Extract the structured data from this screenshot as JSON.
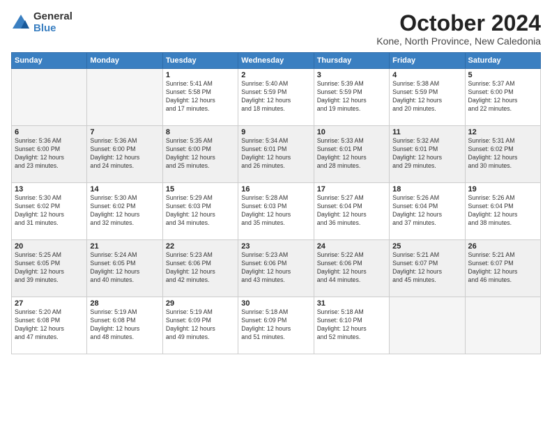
{
  "logo": {
    "general": "General",
    "blue": "Blue"
  },
  "title": "October 2024",
  "location": "Kone, North Province, New Caledonia",
  "days_of_week": [
    "Sunday",
    "Monday",
    "Tuesday",
    "Wednesday",
    "Thursday",
    "Friday",
    "Saturday"
  ],
  "weeks": [
    [
      {
        "num": "",
        "info": ""
      },
      {
        "num": "",
        "info": ""
      },
      {
        "num": "1",
        "info": "Sunrise: 5:41 AM\nSunset: 5:58 PM\nDaylight: 12 hours\nand 17 minutes."
      },
      {
        "num": "2",
        "info": "Sunrise: 5:40 AM\nSunset: 5:59 PM\nDaylight: 12 hours\nand 18 minutes."
      },
      {
        "num": "3",
        "info": "Sunrise: 5:39 AM\nSunset: 5:59 PM\nDaylight: 12 hours\nand 19 minutes."
      },
      {
        "num": "4",
        "info": "Sunrise: 5:38 AM\nSunset: 5:59 PM\nDaylight: 12 hours\nand 20 minutes."
      },
      {
        "num": "5",
        "info": "Sunrise: 5:37 AM\nSunset: 6:00 PM\nDaylight: 12 hours\nand 22 minutes."
      }
    ],
    [
      {
        "num": "6",
        "info": "Sunrise: 5:36 AM\nSunset: 6:00 PM\nDaylight: 12 hours\nand 23 minutes."
      },
      {
        "num": "7",
        "info": "Sunrise: 5:36 AM\nSunset: 6:00 PM\nDaylight: 12 hours\nand 24 minutes."
      },
      {
        "num": "8",
        "info": "Sunrise: 5:35 AM\nSunset: 6:00 PM\nDaylight: 12 hours\nand 25 minutes."
      },
      {
        "num": "9",
        "info": "Sunrise: 5:34 AM\nSunset: 6:01 PM\nDaylight: 12 hours\nand 26 minutes."
      },
      {
        "num": "10",
        "info": "Sunrise: 5:33 AM\nSunset: 6:01 PM\nDaylight: 12 hours\nand 28 minutes."
      },
      {
        "num": "11",
        "info": "Sunrise: 5:32 AM\nSunset: 6:01 PM\nDaylight: 12 hours\nand 29 minutes."
      },
      {
        "num": "12",
        "info": "Sunrise: 5:31 AM\nSunset: 6:02 PM\nDaylight: 12 hours\nand 30 minutes."
      }
    ],
    [
      {
        "num": "13",
        "info": "Sunrise: 5:30 AM\nSunset: 6:02 PM\nDaylight: 12 hours\nand 31 minutes."
      },
      {
        "num": "14",
        "info": "Sunrise: 5:30 AM\nSunset: 6:02 PM\nDaylight: 12 hours\nand 32 minutes."
      },
      {
        "num": "15",
        "info": "Sunrise: 5:29 AM\nSunset: 6:03 PM\nDaylight: 12 hours\nand 34 minutes."
      },
      {
        "num": "16",
        "info": "Sunrise: 5:28 AM\nSunset: 6:03 PM\nDaylight: 12 hours\nand 35 minutes."
      },
      {
        "num": "17",
        "info": "Sunrise: 5:27 AM\nSunset: 6:04 PM\nDaylight: 12 hours\nand 36 minutes."
      },
      {
        "num": "18",
        "info": "Sunrise: 5:26 AM\nSunset: 6:04 PM\nDaylight: 12 hours\nand 37 minutes."
      },
      {
        "num": "19",
        "info": "Sunrise: 5:26 AM\nSunset: 6:04 PM\nDaylight: 12 hours\nand 38 minutes."
      }
    ],
    [
      {
        "num": "20",
        "info": "Sunrise: 5:25 AM\nSunset: 6:05 PM\nDaylight: 12 hours\nand 39 minutes."
      },
      {
        "num": "21",
        "info": "Sunrise: 5:24 AM\nSunset: 6:05 PM\nDaylight: 12 hours\nand 40 minutes."
      },
      {
        "num": "22",
        "info": "Sunrise: 5:23 AM\nSunset: 6:06 PM\nDaylight: 12 hours\nand 42 minutes."
      },
      {
        "num": "23",
        "info": "Sunrise: 5:23 AM\nSunset: 6:06 PM\nDaylight: 12 hours\nand 43 minutes."
      },
      {
        "num": "24",
        "info": "Sunrise: 5:22 AM\nSunset: 6:06 PM\nDaylight: 12 hours\nand 44 minutes."
      },
      {
        "num": "25",
        "info": "Sunrise: 5:21 AM\nSunset: 6:07 PM\nDaylight: 12 hours\nand 45 minutes."
      },
      {
        "num": "26",
        "info": "Sunrise: 5:21 AM\nSunset: 6:07 PM\nDaylight: 12 hours\nand 46 minutes."
      }
    ],
    [
      {
        "num": "27",
        "info": "Sunrise: 5:20 AM\nSunset: 6:08 PM\nDaylight: 12 hours\nand 47 minutes."
      },
      {
        "num": "28",
        "info": "Sunrise: 5:19 AM\nSunset: 6:08 PM\nDaylight: 12 hours\nand 48 minutes."
      },
      {
        "num": "29",
        "info": "Sunrise: 5:19 AM\nSunset: 6:09 PM\nDaylight: 12 hours\nand 49 minutes."
      },
      {
        "num": "30",
        "info": "Sunrise: 5:18 AM\nSunset: 6:09 PM\nDaylight: 12 hours\nand 51 minutes."
      },
      {
        "num": "31",
        "info": "Sunrise: 5:18 AM\nSunset: 6:10 PM\nDaylight: 12 hours\nand 52 minutes."
      },
      {
        "num": "",
        "info": ""
      },
      {
        "num": "",
        "info": ""
      }
    ]
  ]
}
